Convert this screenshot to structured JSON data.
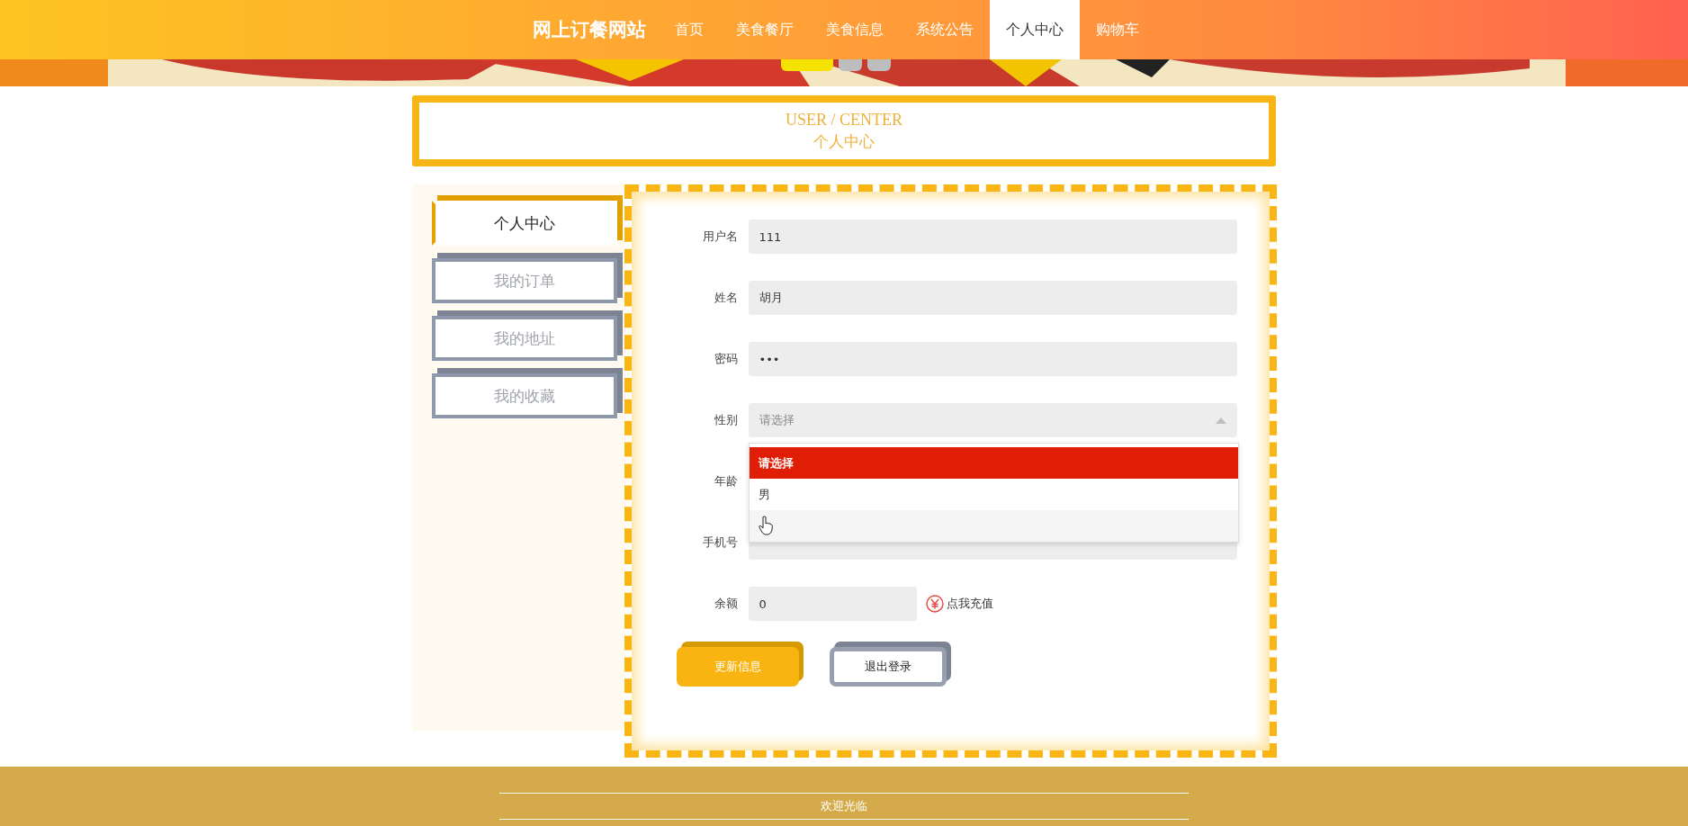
{
  "header": {
    "brand": "网上订餐网站",
    "nav": [
      {
        "label": "首页",
        "selected": false
      },
      {
        "label": "美食餐厅",
        "selected": false
      },
      {
        "label": "美食信息",
        "selected": false
      },
      {
        "label": "系统公告",
        "selected": false
      },
      {
        "label": "个人中心",
        "selected": true
      },
      {
        "label": "购物车",
        "selected": false
      }
    ]
  },
  "banner": {
    "dots": [
      {
        "selected": true
      },
      {
        "selected": false
      },
      {
        "selected": false
      }
    ]
  },
  "page_title": {
    "english": "USER / CENTER",
    "chinese": "个人中心"
  },
  "sidebar": {
    "items": [
      {
        "label": "个人中心",
        "selected": true
      },
      {
        "label": "我的订单",
        "selected": false
      },
      {
        "label": "我的地址",
        "selected": false
      },
      {
        "label": "我的收藏",
        "selected": false
      }
    ]
  },
  "form": {
    "fields": [
      {
        "label": "用户名",
        "kind": "text",
        "value": "111"
      },
      {
        "label": "姓名",
        "kind": "text",
        "value": "胡月"
      },
      {
        "label": "密码",
        "kind": "password",
        "value": "•••"
      },
      {
        "label": "性别",
        "kind": "select",
        "placeholder": "请选择",
        "expanded": true,
        "options": [
          {
            "label": "请选择",
            "selected": true,
            "hovered": false
          },
          {
            "label": "男",
            "selected": false,
            "hovered": false
          },
          {
            "selected": false,
            "hovered": true
          }
        ]
      },
      {
        "label": "年龄",
        "kind": "text"
      },
      {
        "label": "手机号",
        "kind": "text"
      },
      {
        "label": "余额",
        "kind": "balance",
        "value": "0",
        "link": "点我充值"
      }
    ],
    "buttons": [
      {
        "label": "更新信息",
        "kind": "primary"
      },
      {
        "label": "退出登录",
        "kind": "secondary"
      }
    ]
  },
  "footer": {
    "text": "欢迎光临"
  }
}
